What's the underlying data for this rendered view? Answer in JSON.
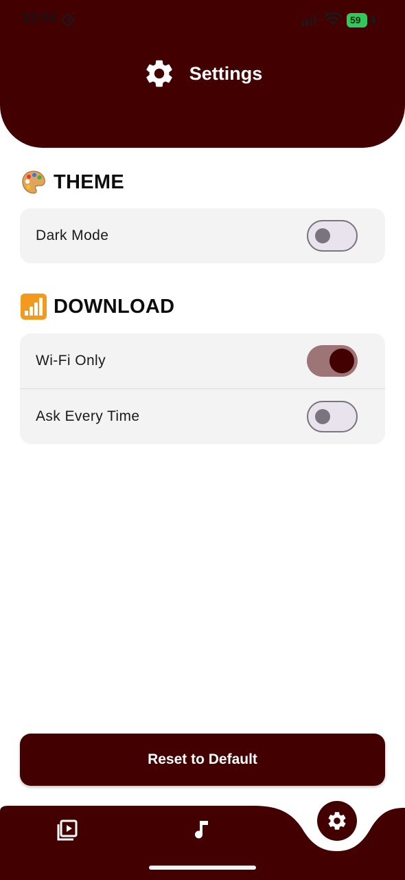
{
  "status_bar": {
    "time": "12:51",
    "battery_level": "59"
  },
  "header": {
    "title": "Settings",
    "icon": "gear-icon"
  },
  "sections": [
    {
      "title": "THEME",
      "icon": "artist-palette-emoji",
      "rows": [
        {
          "label": "Dark Mode",
          "enabled": false
        }
      ]
    },
    {
      "title": "DOWNLOAD",
      "icon": "signal-bars-emoji",
      "rows": [
        {
          "label": "Wi-Fi Only",
          "enabled": true
        },
        {
          "label": "Ask Every Time",
          "enabled": false
        }
      ]
    }
  ],
  "reset_button": {
    "label": "Reset to Default"
  },
  "bottom_nav": {
    "items": [
      {
        "icon": "video-library-icon",
        "active": false
      },
      {
        "icon": "music-note-icon",
        "active": false
      },
      {
        "icon": "gear-icon",
        "active": true
      }
    ]
  },
  "colors": {
    "primary": "#430000",
    "card_background": "#f3f3f3",
    "switch_on_track": "#9d7576",
    "switch_off_track": "#e8e3ec",
    "switch_off_border": "#79747e",
    "battery_green": "#34c759"
  }
}
